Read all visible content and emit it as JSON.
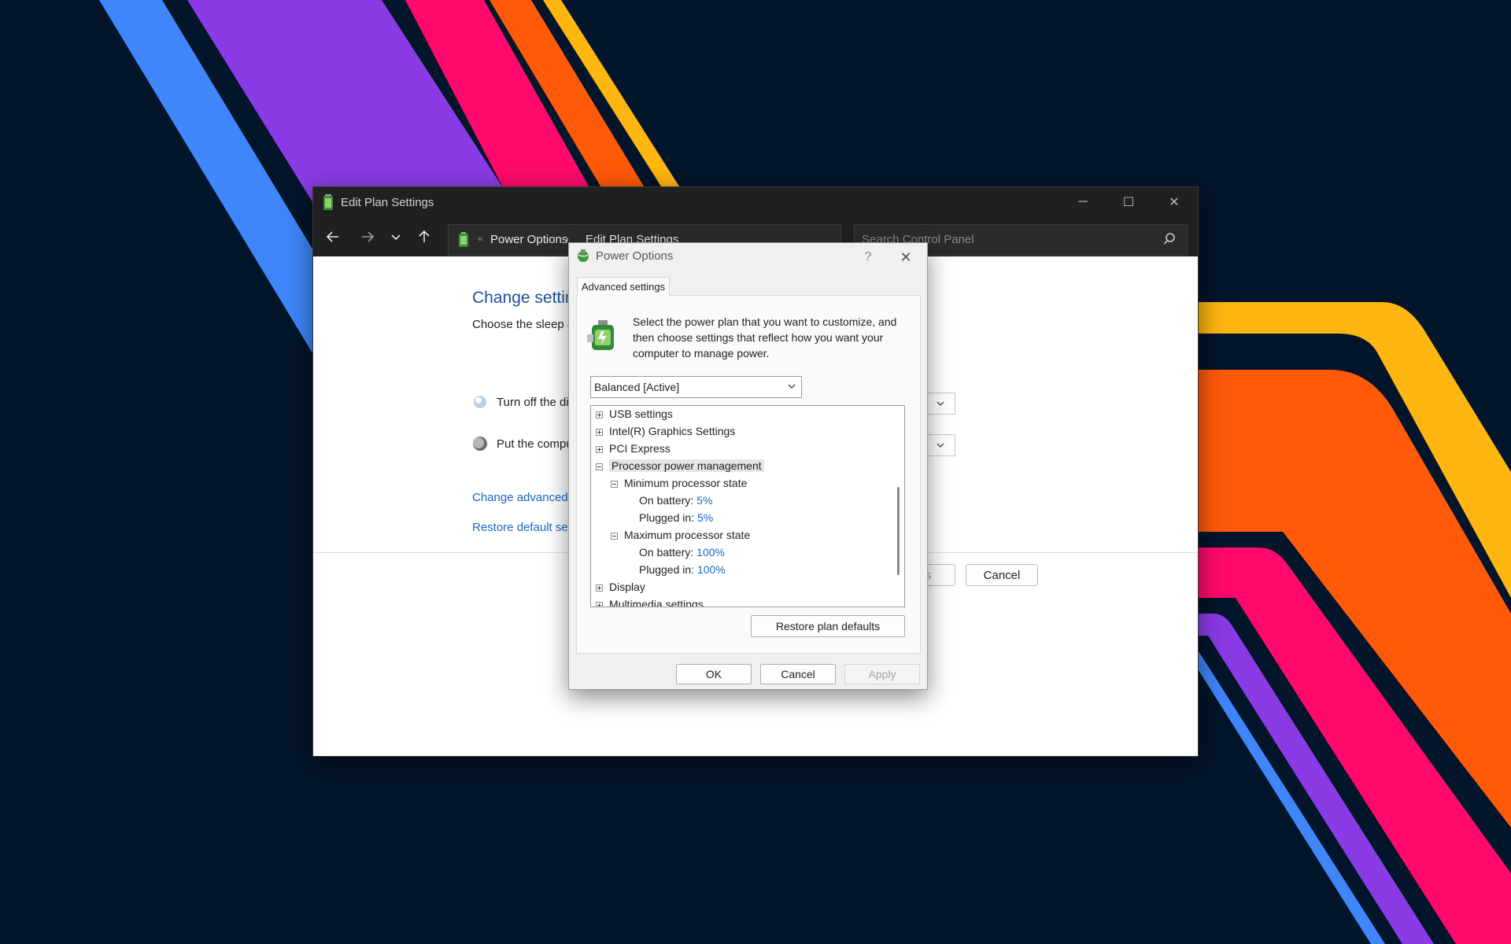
{
  "window": {
    "title": "Edit Plan Settings",
    "caption": {
      "minimize": "─",
      "maximize": "☐",
      "close": "✕"
    },
    "breadcrumb": {
      "first_sep": "«",
      "items": [
        "Power Options",
        "Edit Plan Settings"
      ],
      "arrow": "›"
    },
    "search_placeholder": "Search Control Panel",
    "content": {
      "heading": "Change setting",
      "description": "Choose the sleep a",
      "rows": [
        {
          "label": "Turn off the di"
        },
        {
          "label": "Put the compu"
        }
      ],
      "links": [
        "Change advanced",
        "Restore default set"
      ],
      "save_button_partial": "es",
      "cancel_button": "Cancel"
    }
  },
  "dialog": {
    "title": "Power Options",
    "help": "?",
    "close": "✕",
    "tab": "Advanced settings",
    "intro": "Select the power plan that you want to customize, and then choose settings that reflect how you want your computer to manage power.",
    "plan_select": "Balanced [Active]",
    "tree": [
      {
        "label": "USB settings",
        "expander": "plus"
      },
      {
        "label": "Intel(R) Graphics Settings",
        "expander": "plus"
      },
      {
        "label": "PCI Express",
        "expander": "plus"
      },
      {
        "label": "Processor power management",
        "expander": "minus"
      },
      {
        "label": "Minimum processor state",
        "expander": "minus"
      },
      {
        "label": "On battery:",
        "value": "5%"
      },
      {
        "label": "Plugged in:",
        "value": "5%"
      },
      {
        "label": "Maximum processor state",
        "expander": "minus"
      },
      {
        "label": "On battery:",
        "value": "100%"
      },
      {
        "label": "Plugged in:",
        "value": "100%"
      },
      {
        "label": "Display",
        "expander": "plus"
      },
      {
        "label": "Multimedia settings",
        "expander": "plus"
      }
    ],
    "restore_button": "Restore plan defaults",
    "buttons": {
      "ok": "OK",
      "cancel": "Cancel",
      "apply": "Apply"
    }
  },
  "colors": {
    "desktop": "#03152a",
    "stripe_blue": "#3f86fb",
    "stripe_purple": "#8b3be6",
    "stripe_pink": "#ff0a6c",
    "stripe_orange": "#ff5a0a",
    "stripe_yellow": "#ffb611",
    "link": "#1a66c4"
  }
}
